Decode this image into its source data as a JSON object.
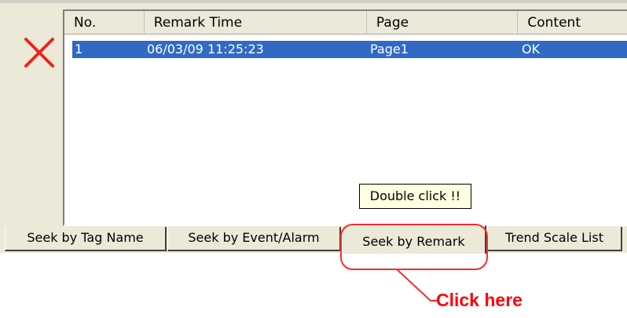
{
  "listview": {
    "columns": [
      "No.",
      "Remark Time",
      "Page",
      "Content"
    ],
    "rows": [
      {
        "no": "1",
        "time": "06/03/09 11:25:23",
        "page": "Page1",
        "content": "OK"
      }
    ]
  },
  "tooltip": "Double click !!",
  "tabs": [
    {
      "label": "Seek by Tag Name"
    },
    {
      "label": "Seek by Event/Alarm"
    },
    {
      "label": "Seek by Remark"
    },
    {
      "label": "Trend Scale List"
    }
  ],
  "annotation": {
    "text": "Click here",
    "color": "#ff0000"
  },
  "colors": {
    "selection": "#316ac5",
    "panel": "#ece9d8",
    "tooltip": "#ffffe1"
  },
  "icons": {
    "close": "close-x-icon"
  }
}
